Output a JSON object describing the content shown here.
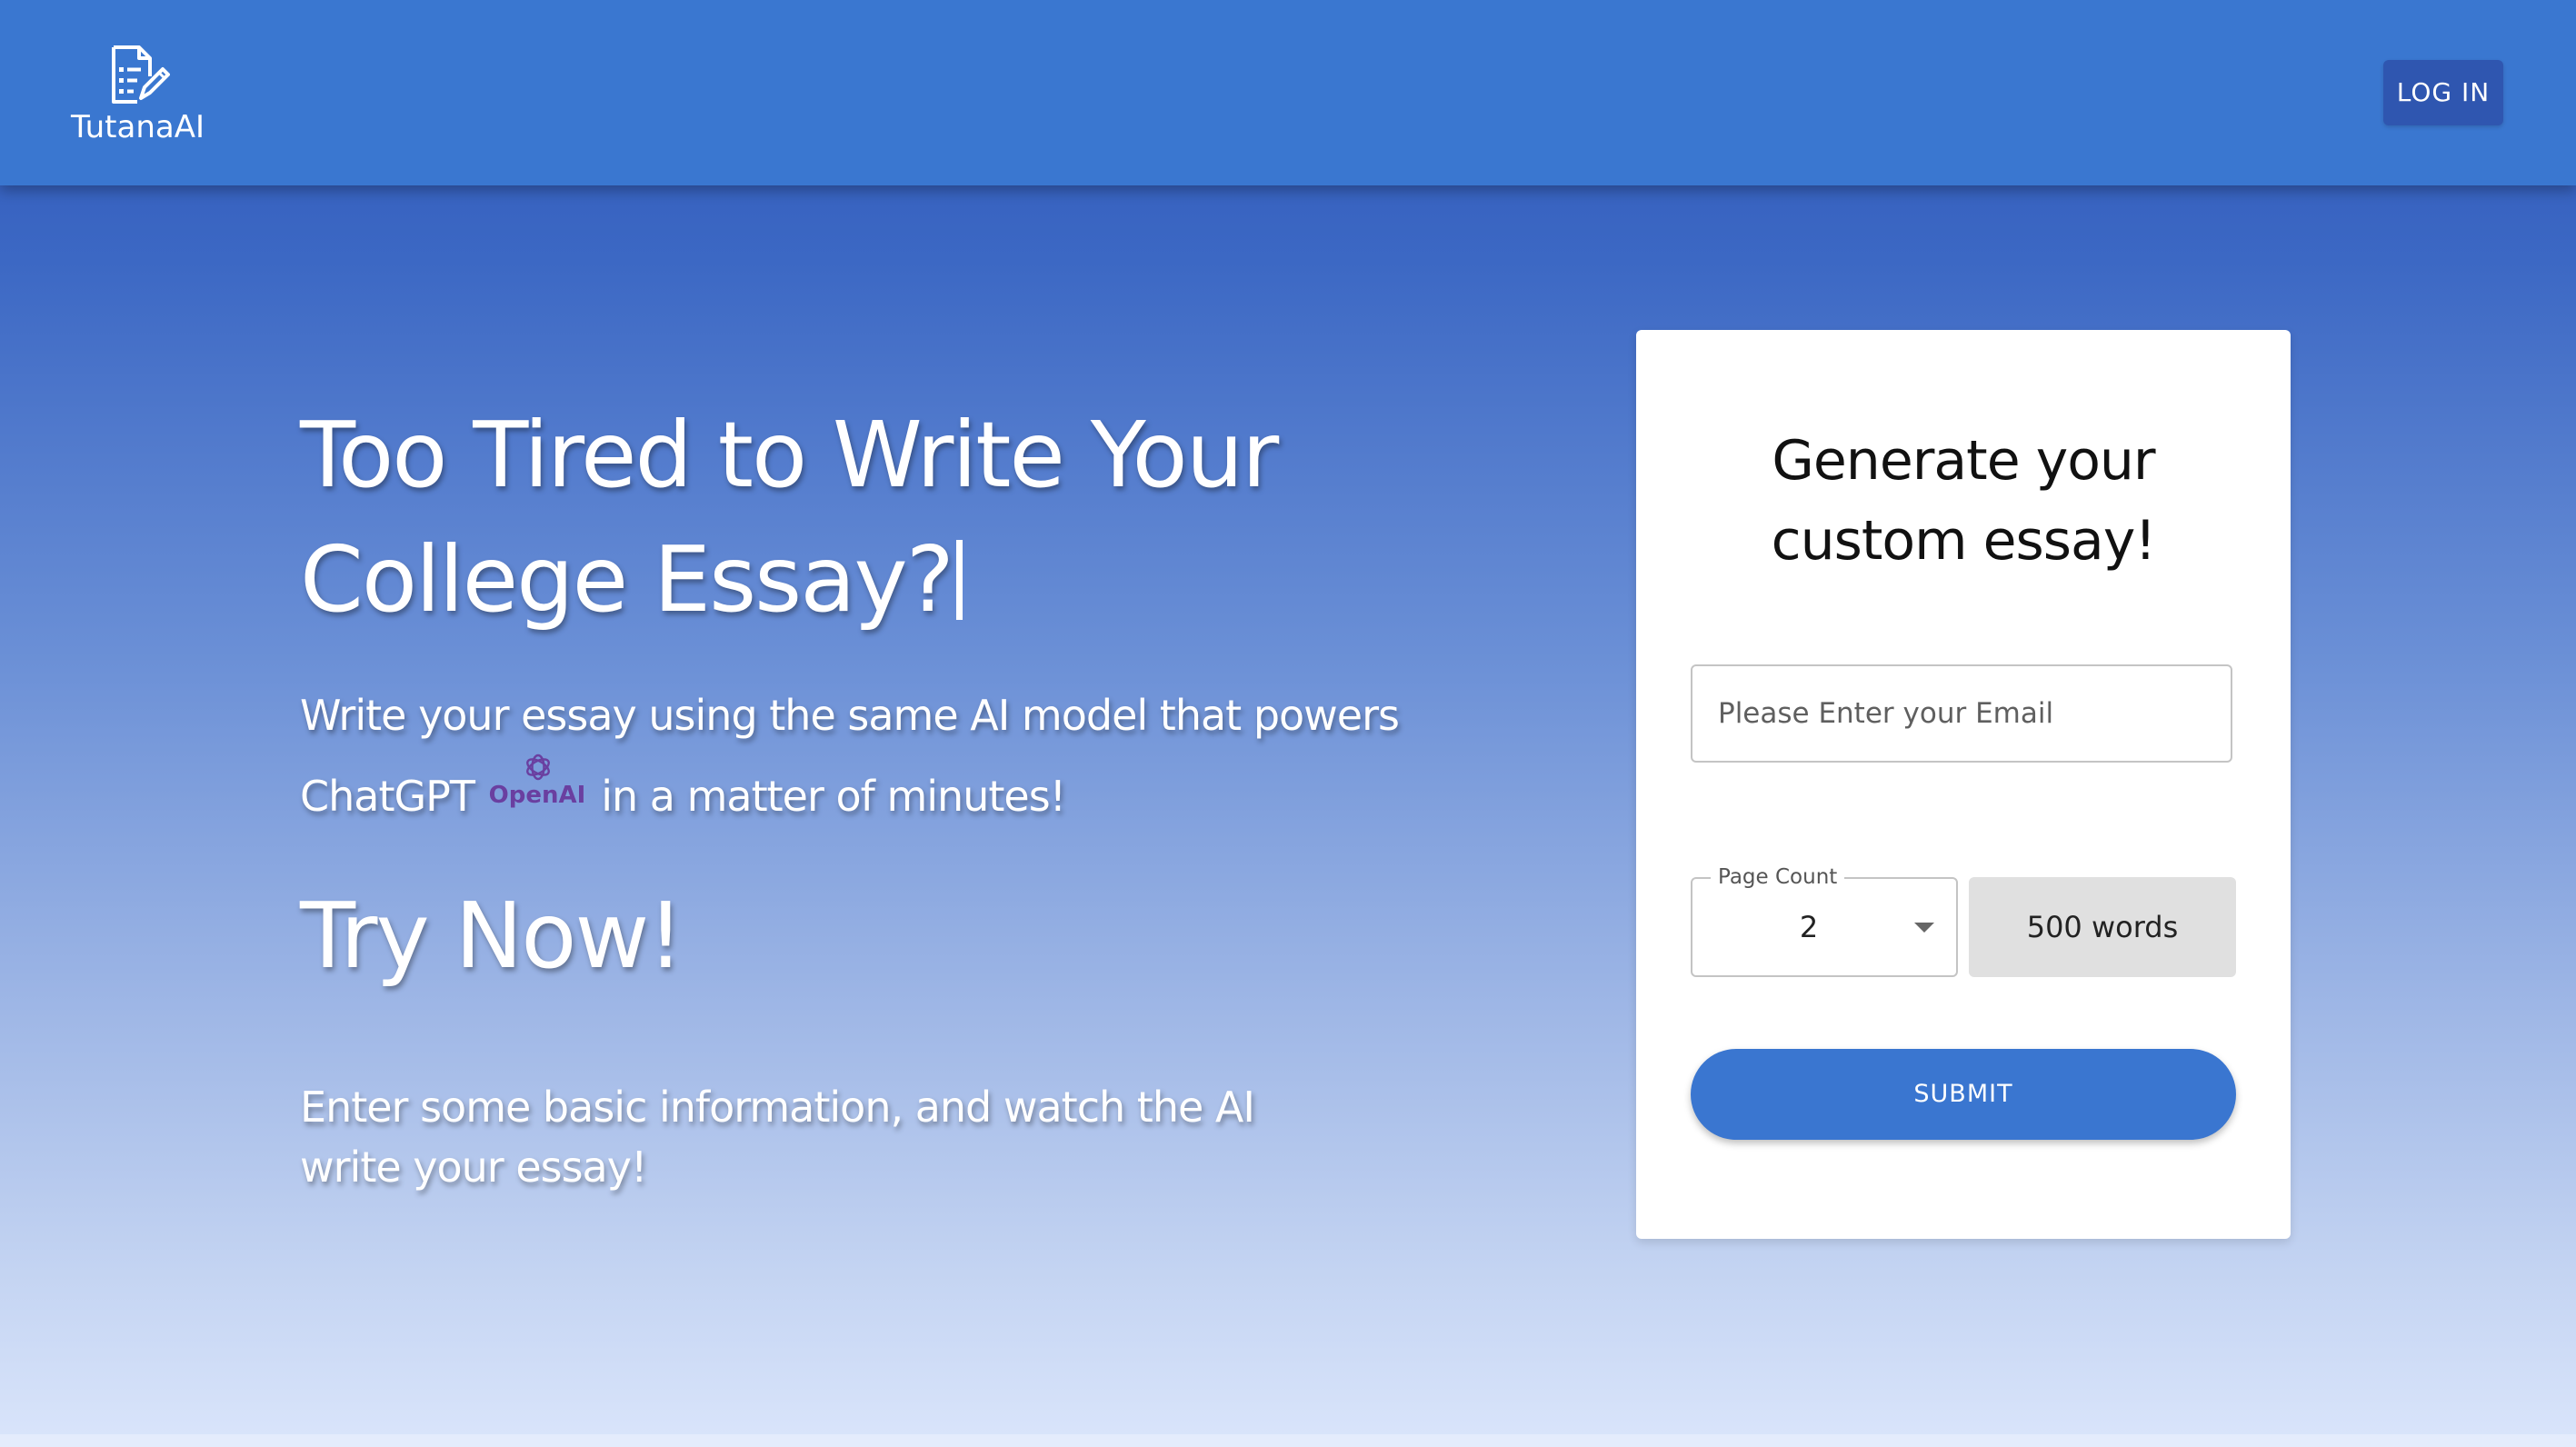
{
  "header": {
    "brand": "TutanaAI",
    "logo_icon": "document-pencil-icon",
    "login_label": "LOG IN"
  },
  "hero": {
    "title": "Too Tired to Write Your College Essay?",
    "subtitle_before": "Write your essay using the same AI model that powers ChatGPT",
    "openai_logo_text": "OpenAI",
    "openai_icon": "openai-logo-icon",
    "subtitle_after": "in a matter of minutes!",
    "try_now": "Try Now!",
    "info": "Enter some basic information, and watch the AI write your essay!"
  },
  "form": {
    "title_line1": "Generate your",
    "title_line2": "custom essay!",
    "email_placeholder": "Please Enter your Email",
    "email_value": "",
    "page_count_label": "Page Count",
    "page_count_value": "2",
    "words_label": "500 words",
    "submit_label": "SUBMIT"
  },
  "colors": {
    "appbar": "#3a77d0",
    "login_button": "#2f56b0",
    "submit_button": "#3a76d0",
    "openai_text": "#6a3fa0"
  }
}
